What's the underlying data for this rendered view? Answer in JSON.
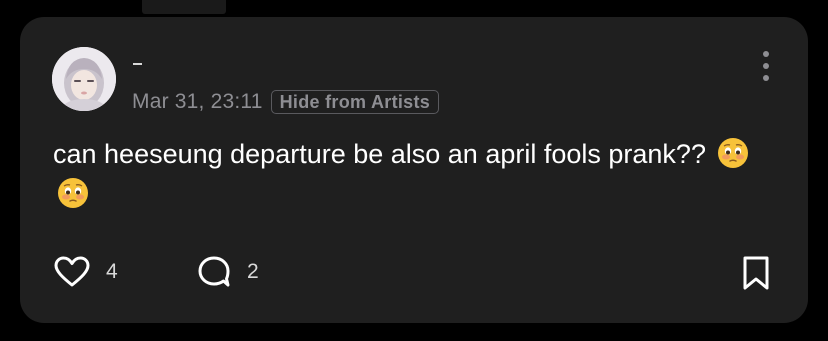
{
  "post": {
    "author": "—",
    "timestamp": "Mar 31, 23:11",
    "visibility_badge": "Hide from Artists",
    "text": "can heeseung departure be also an april fools prank??",
    "emojis": [
      "flushed-face-emoji",
      "flushed-face-emoji"
    ]
  },
  "actions": {
    "likes": "4",
    "comments": "2"
  },
  "icons": {
    "like": "heart-icon",
    "comment": "chat-bubble-icon",
    "bookmark": "bookmark-icon",
    "more": "vertical-ellipsis-icon"
  },
  "colors": {
    "background": "#000000",
    "card": "#1f1f1f",
    "text_primary": "#ffffff",
    "text_secondary": "#8e8e93"
  }
}
